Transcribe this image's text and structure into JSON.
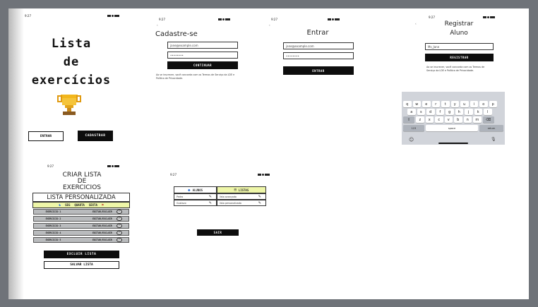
{
  "status_time": "9:27",
  "screen1": {
    "title_line1": "Lista",
    "title_line2": "de",
    "title_line3": "exercícios",
    "enter_button": "ENTRAR",
    "register_button": "CADASTRAR"
  },
  "screen2": {
    "heading": "Cadastre-se",
    "email_placeholder": "jane@example.com",
    "password_placeholder": "••••••••",
    "continue_button": "CONTINUAR",
    "terms_text": "Ao se inscrever, você concorda com os Termos de Serviço da LDE e Política de Privacidade."
  },
  "screen3": {
    "heading": "Entrar",
    "email_placeholder": "jane@example.com",
    "password_placeholder": "••••••••",
    "enter_button": "ENTRAR"
  },
  "screen4": {
    "heading_line1": "Registrar",
    "heading_line2": "Aluno",
    "name_value": "Ms_Jane",
    "register_button": "REGISTRAR",
    "terms_text": "Ao se inscrever, você concorda com os Termos de Serviço da LDE e Política de Privacidade.",
    "keyboard": {
      "row1": [
        "q",
        "w",
        "e",
        "r",
        "t",
        "y",
        "u",
        "i",
        "o",
        "p"
      ],
      "row2": [
        "a",
        "s",
        "d",
        "f",
        "g",
        "h",
        "j",
        "k",
        "l"
      ],
      "row3": [
        "z",
        "x",
        "c",
        "v",
        "b",
        "n",
        "m"
      ],
      "num_key": "123",
      "space_key": "space",
      "return_key": "return"
    }
  },
  "screen5": {
    "heading_line1": "CRIAR LISTA",
    "heading_line2": "DE",
    "heading_line3": "EXERCICIOS",
    "banner": "LISTA PERSONALIZADA",
    "days": [
      "SEG",
      "QUARTA",
      "SEXTA"
    ],
    "exercises": [
      {
        "name": "EXERCICIO 1",
        "action": "EDITAR/EXCLUIR"
      },
      {
        "name": "EXERCICIO 2",
        "action": "EDITAR/EXCLUIR"
      },
      {
        "name": "EXERCICIO 3",
        "action": "EDITAR/EXCLUIR"
      },
      {
        "name": "EXERCICIO 4",
        "action": "EDITAR/EXCLUIR"
      },
      {
        "name": "EXERCICIO 5",
        "action": "EDITAR/EXCLUIR"
      }
    ],
    "delete_button": "EXCLUIR LISTA",
    "save_button": "SALVAR LISTA"
  },
  "screen6": {
    "tab_students": "ALUNOS",
    "tab_lists": "LISTAS",
    "students": [
      "Pedro",
      "Gustavo"
    ],
    "lists": [
      "lista avançado",
      "lista personalizada"
    ],
    "exit_button": "SAIR"
  }
}
